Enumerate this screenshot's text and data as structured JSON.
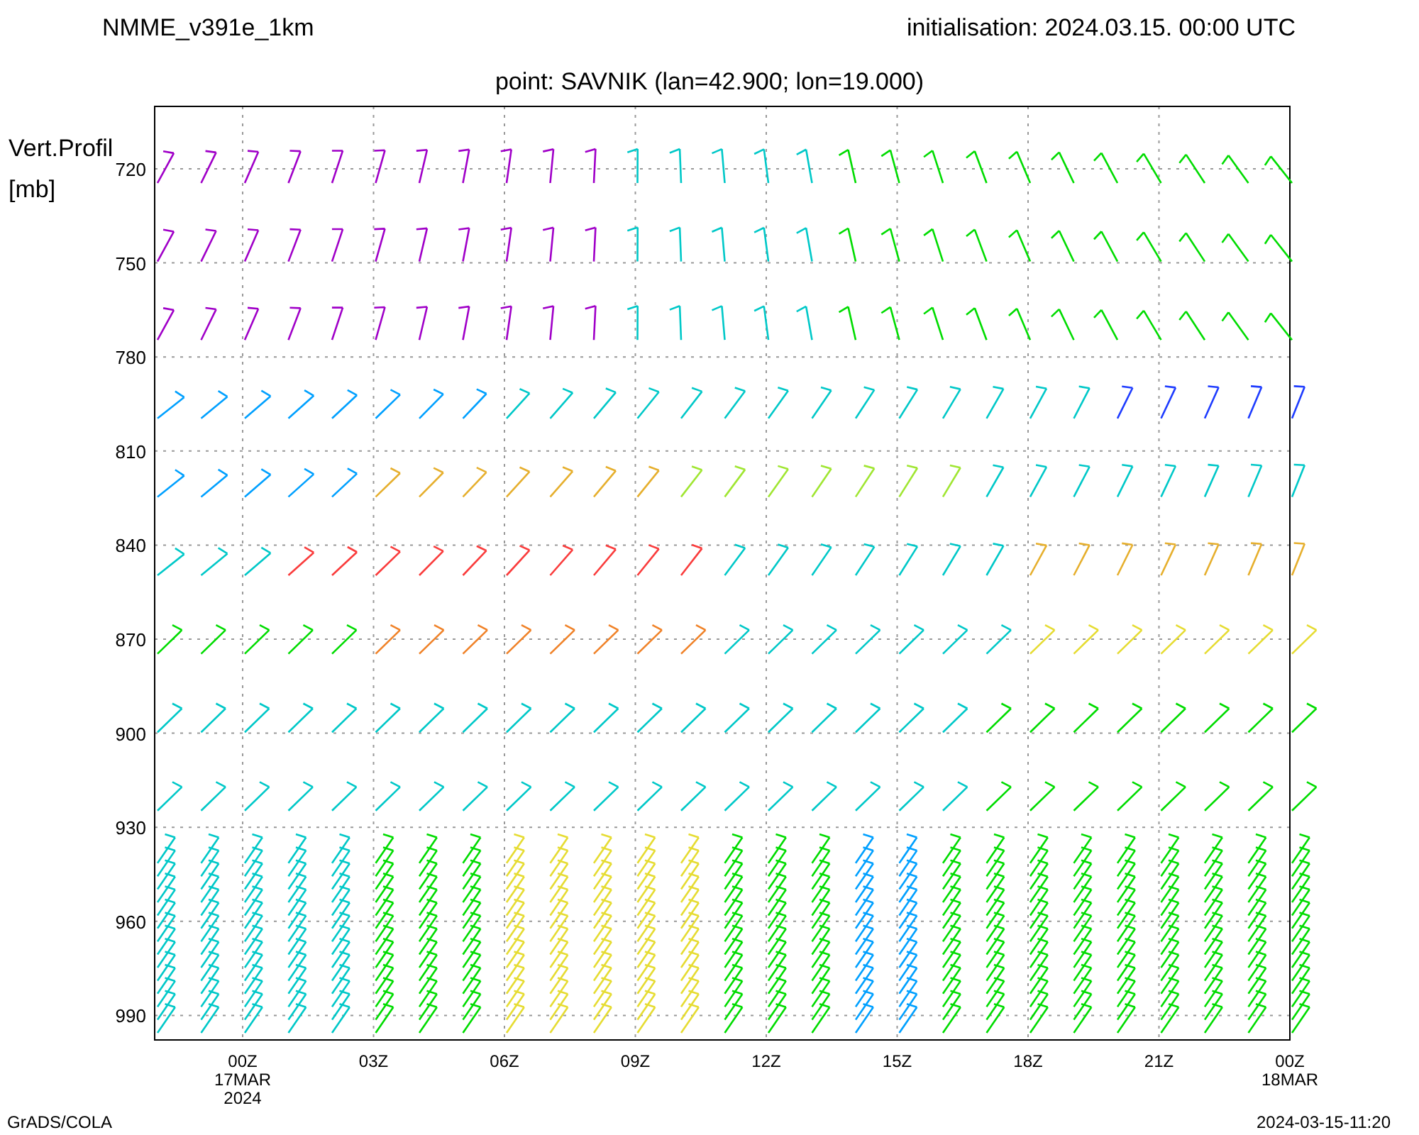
{
  "header": {
    "model": "NMME_v391e_1km",
    "initialisation": "initialisation: 2024.03.15. 00:00 UTC",
    "point": "point: SAVNIK (lan=42.900; lon=19.000)"
  },
  "y_axis": {
    "title": "Vert.Profil",
    "unit": "[mb]",
    "ticks": [
      "720",
      "750",
      "780",
      "810",
      "840",
      "870",
      "900",
      "930",
      "960",
      "990"
    ]
  },
  "x_axis": {
    "ticks": [
      {
        "lines": [
          "00Z",
          "17MAR",
          "2024"
        ]
      },
      {
        "lines": [
          "03Z"
        ]
      },
      {
        "lines": [
          "06Z"
        ]
      },
      {
        "lines": [
          "09Z"
        ]
      },
      {
        "lines": [
          "12Z"
        ]
      },
      {
        "lines": [
          "15Z"
        ]
      },
      {
        "lines": [
          "18Z"
        ]
      },
      {
        "lines": [
          "21Z"
        ]
      },
      {
        "lines": [
          "00Z",
          "18MAR"
        ]
      }
    ]
  },
  "footer": {
    "left": "GrADS/COLA",
    "right": "2024-03-15-11:20"
  }
}
